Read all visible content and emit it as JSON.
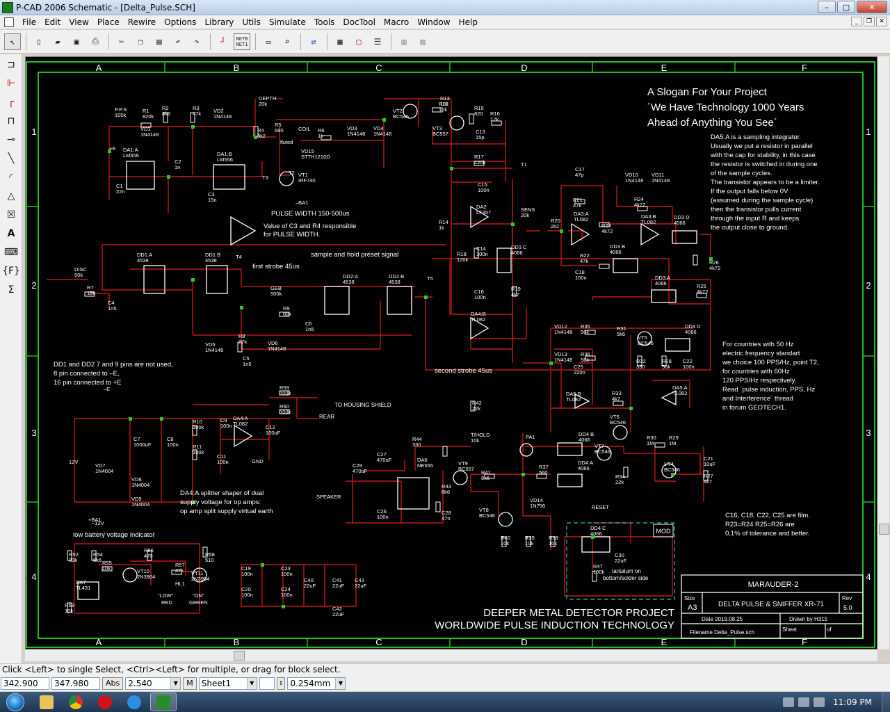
{
  "window": {
    "title": "P-CAD 2006 Schematic - [Delta_Pulse.SCH]",
    "controls": [
      "–",
      "□",
      "✕"
    ]
  },
  "menu": [
    "File",
    "Edit",
    "View",
    "Place",
    "Rewire",
    "Options",
    "Library",
    "Utils",
    "Simulate",
    "Tools",
    "DocTool",
    "Macro",
    "Window",
    "Help"
  ],
  "toolbar": {
    "netlist_top": "NETB",
    "netlist_bottom": "NET1"
  },
  "schematic": {
    "columns": [
      "A",
      "B",
      "C",
      "D",
      "E",
      "F"
    ],
    "rows": [
      "1",
      "2",
      "3",
      "4"
    ],
    "slogan": [
      "A Slogan For Your Project",
      "´We Have Technology 1000 Years",
      "Ahead of Anything You See´"
    ],
    "note_da5": [
      "DA5:A is a sampling integrator.",
      "Usually we put a resistor in parallel",
      "with the cap for stability, in this case",
      "the resistor is switched in during one",
      "of the sample cycles.",
      "The transistor appears to be a limiter.",
      "If the output falls below 0V",
      "(assumed during the sample cycle)",
      "then the transistor pulls current",
      "through the input R and keeps",
      "the output close to ground."
    ],
    "note_pps": [
      "For countries with 50 Hz",
      "electric frequency standart",
      "we choice 100 PPS/Hz, point T2,",
      "for countries with 60Hz",
      "120 PPS/Hz respectively.",
      "Read ´pulse induction, PPS, Hz",
      "and Interference´ thread",
      "in forum GEOTECH1."
    ],
    "note_dd": [
      "DD1 and DD2 7 and 9 pins are not used,",
      "8 pin connected to –E,",
      "16 pin connected to +E"
    ],
    "note_da4": [
      "DA4:A splitter shaper of dual",
      "supply voltage for op amps:",
      "op amp split supply virtual earth"
    ],
    "note_film": [
      "C16, C18, C22, C25 are film.",
      "R23=R24 R25=R26 are",
      "0,1% of tolerance and better."
    ],
    "label_pulse_width": "PULSE WIDTH 150-500us",
    "label_c3r4": [
      "Value of C3 and R4 responsible",
      "for PULSE WIDTH."
    ],
    "label_sample_hold": "sample and hold preset signal",
    "label_first_strobe": "first strobe 45us",
    "label_second_strobe": "second strobe 45us",
    "label_low_battery": "low battery voltage indicator",
    "label_housing": "TO HOUSING SHIELD",
    "label_rear": "REAR",
    "label_tantalum": [
      "tantalum on",
      "bottom/solder side"
    ],
    "label_mod": "MOD",
    "title_block": {
      "project": "MARAUDER-2",
      "size_label": "Size",
      "size": "A3",
      "name": "DELTA PULSE & SNIFFER XR-71",
      "rev_label": "Rev",
      "rev": "5.0",
      "date": "Date   2019.08.25",
      "drawn": "Drawn by  H315",
      "filename": "Filename Delta_Pulse.sch",
      "sheet": "Sheet",
      "of": "of"
    },
    "footer": [
      "DEEPER METAL DETECTOR PROJECT",
      "WORLDWIDE PULSE INDUCTION TECHNOLOGY"
    ],
    "components": [
      {
        "ref": "P.P.S",
        "val": "100k"
      },
      {
        "ref": "R1",
        "val": "820k"
      },
      {
        "ref": "R2",
        "val": "8k6"
      },
      {
        "ref": "R3",
        "val": "47k"
      },
      {
        "ref": "VD2",
        "val": "1N4148"
      },
      {
        "ref": "VD1",
        "val": "1N4148"
      },
      {
        "ref": "DA1:A",
        "val": "LM556"
      },
      {
        "ref": "DA1:B",
        "val": "LM556"
      },
      {
        "ref": "C1",
        "val": "22n"
      },
      {
        "ref": "C2",
        "val": "1n"
      },
      {
        "ref": "C3",
        "val": "15n"
      },
      {
        "ref": "DEPTH",
        "val": "20k"
      },
      {
        "ref": "R4",
        "val": "8k2"
      },
      {
        "ref": "R5",
        "val": "680"
      },
      {
        "ref": "COIL",
        "val": ""
      },
      {
        "ref": "R6",
        "val": "1k"
      },
      {
        "ref": "VD3",
        "val": "1N4148"
      },
      {
        "ref": "VD4",
        "val": "1N4148"
      },
      {
        "ref": "VD15",
        "val": "STTH1210D"
      },
      {
        "ref": "VT1",
        "val": "IRF740"
      },
      {
        "ref": "VT2",
        "val": "BC546"
      },
      {
        "ref": "R12",
        "val": "10k"
      },
      {
        "ref": "R13",
        "val": "10k"
      },
      {
        "ref": "VT3",
        "val": "BC557"
      },
      {
        "ref": "R15",
        "val": "820"
      },
      {
        "ref": "R16",
        "val": "12k"
      },
      {
        "ref": "C13",
        "val": "15p"
      },
      {
        "ref": "R17",
        "val": "120k"
      },
      {
        "ref": "C15",
        "val": "100n"
      },
      {
        "ref": "DA2",
        "val": "LF357"
      },
      {
        "ref": "R14",
        "val": "1k"
      },
      {
        "ref": "R18",
        "val": "120k"
      },
      {
        "ref": "C14",
        "val": "100n"
      },
      {
        "ref": "DD3 C",
        "val": "4066"
      },
      {
        "ref": "R19",
        "val": "4k7"
      },
      {
        "ref": "C16",
        "val": "100n"
      },
      {
        "ref": "DA4:B",
        "val": "TL082"
      },
      {
        "ref": "SENS",
        "val": "20k"
      },
      {
        "ref": "R20",
        "val": "2k2"
      },
      {
        "ref": "C17",
        "val": "47p"
      },
      {
        "ref": "R21",
        "val": "47k"
      },
      {
        "ref": "DA3:A",
        "val": "TL082"
      },
      {
        "ref": "R23",
        "val": "4k72"
      },
      {
        "ref": "R22",
        "val": "47k"
      },
      {
        "ref": "C18",
        "val": "100n"
      },
      {
        "ref": "VD10",
        "val": "1N4148"
      },
      {
        "ref": "VD11",
        "val": "1N4148"
      },
      {
        "ref": "R24",
        "val": "4k72"
      },
      {
        "ref": "DA3:B",
        "val": "TL082"
      },
      {
        "ref": "DD3 D",
        "val": "4066"
      },
      {
        "ref": "DD3 B",
        "val": "4066"
      },
      {
        "ref": "R26",
        "val": "4k72"
      },
      {
        "ref": "DD3:A",
        "val": "4066"
      },
      {
        "ref": "R25",
        "val": "4k72"
      },
      {
        "ref": "DISC",
        "val": "50k"
      },
      {
        "ref": "R7",
        "val": "15k"
      },
      {
        "ref": "C4",
        "val": "1n5"
      },
      {
        "ref": "DD1:A",
        "val": "4538"
      },
      {
        "ref": "DD1 B",
        "val": "4538"
      },
      {
        "ref": "GEB",
        "val": "500k"
      },
      {
        "ref": "R9",
        "val": "68k"
      },
      {
        "ref": "C6",
        "val": "1n5"
      },
      {
        "ref": "DD2:A",
        "val": "4538"
      },
      {
        "ref": "DD2 B",
        "val": "4538"
      },
      {
        "ref": "VD5",
        "val": "1N4148"
      },
      {
        "ref": "R8",
        "val": "27k"
      },
      {
        "ref": "C5",
        "val": "1n5"
      },
      {
        "ref": "VD6",
        "val": "1N4148"
      },
      {
        "ref": "VD12",
        "val": "1N4148"
      },
      {
        "ref": "R35",
        "val": "56k"
      },
      {
        "ref": "R31",
        "val": "5k6"
      },
      {
        "ref": "VT5",
        "val": "BC546"
      },
      {
        "ref": "DD4 D",
        "val": "4066"
      },
      {
        "ref": "VD13",
        "val": "1N4148"
      },
      {
        "ref": "R36",
        "val": "56k"
      },
      {
        "ref": "C25",
        "val": "220n"
      },
      {
        "ref": "R32",
        "val": "330"
      },
      {
        "ref": "R28",
        "val": "56k"
      },
      {
        "ref": "C22",
        "val": "100n"
      },
      {
        "ref": "DA5:B",
        "val": "TL082"
      },
      {
        "ref": "R33",
        "val": "4k7"
      },
      {
        "ref": "DA5:A",
        "val": "TL082"
      },
      {
        "ref": "VT6",
        "val": "BC546"
      },
      {
        "ref": "R30",
        "val": "1M"
      },
      {
        "ref": "R29",
        "val": "1M"
      },
      {
        "ref": "C21",
        "val": "10uF"
      },
      {
        "ref": "R27",
        "val": "4k7"
      },
      {
        "ref": "VT4",
        "val": "BC546"
      },
      {
        "ref": "VT7",
        "val": "BC546"
      },
      {
        "ref": "R34",
        "val": "22k"
      },
      {
        "ref": "DD4 B",
        "val": "4066"
      },
      {
        "ref": "DD4:A",
        "val": "4066"
      },
      {
        "ref": "T/HOLD",
        "val": "10k"
      },
      {
        "ref": "R42",
        "val": "22k"
      },
      {
        "ref": "PA1",
        "val": ""
      },
      {
        "ref": "R37",
        "val": "560"
      },
      {
        "ref": "R41",
        "val": "8k6"
      },
      {
        "ref": "VT9",
        "val": "BC557"
      },
      {
        "ref": "R44",
        "val": "330"
      },
      {
        "ref": "C27",
        "val": "470uF"
      },
      {
        "ref": "DA6",
        "val": "NE555"
      },
      {
        "ref": "C29",
        "val": "470uF"
      },
      {
        "ref": "R43",
        "val": "8k6"
      },
      {
        "ref": "C26",
        "val": "100n"
      },
      {
        "ref": "C28",
        "val": "47n"
      },
      {
        "ref": "VT8",
        "val": "BC546"
      },
      {
        "ref": "VD14",
        "val": "1N756"
      },
      {
        "ref": "R40",
        "val": "10k"
      },
      {
        "ref": "R39",
        "val": "10k"
      },
      {
        "ref": "R38",
        "val": "10k"
      },
      {
        "ref": "DD4 C",
        "val": "4066"
      },
      {
        "ref": "C30",
        "val": "22uF"
      },
      {
        "ref": "R47",
        "val": "100k"
      },
      {
        "ref": "R59",
        "val": "100k"
      },
      {
        "ref": "R60",
        "val": "100k"
      },
      {
        "ref": "R10",
        "val": "100k"
      },
      {
        "ref": "C9",
        "val": "100n"
      },
      {
        "ref": "DA4:A",
        "val": "TL082"
      },
      {
        "ref": "C12",
        "val": "100uF"
      },
      {
        "ref": "C7",
        "val": "1000uF"
      },
      {
        "ref": "C8",
        "val": "100n"
      },
      {
        "ref": "R11",
        "val": "100k"
      },
      {
        "ref": "C11",
        "val": "100n"
      },
      {
        "ref": "VD7",
        "val": "1N4004"
      },
      {
        "ref": "VD8",
        "val": "1N4004"
      },
      {
        "ref": "VD9",
        "val": "1N4004"
      },
      {
        "ref": "R52",
        "val": "33k"
      },
      {
        "ref": "R54",
        "val": "5k6"
      },
      {
        "ref": "R55",
        "val": "10k"
      },
      {
        "ref": "R56",
        "val": "470"
      },
      {
        "ref": "VT10",
        "val": "2N3904"
      },
      {
        "ref": "R57",
        "val": "47k"
      },
      {
        "ref": "VT11",
        "val": "2N3904"
      },
      {
        "ref": "R58",
        "val": "510"
      },
      {
        "ref": "DA7",
        "val": "TL431"
      },
      {
        "ref": "R53",
        "val": "10k"
      },
      {
        "ref": "HL1",
        "val": ""
      },
      {
        "ref": "C19",
        "val": "100n"
      },
      {
        "ref": "C20",
        "val": "100n"
      },
      {
        "ref": "C23",
        "val": "100n"
      },
      {
        "ref": "C24",
        "val": "100n"
      },
      {
        "ref": "C40",
        "val": "22uF"
      },
      {
        "ref": "C41",
        "val": "22uF"
      },
      {
        "ref": "C42",
        "val": "22uF"
      },
      {
        "ref": "C43",
        "val": "22uF"
      }
    ],
    "misc_labels": [
      "T1",
      "T2",
      "T3",
      "T4",
      "T5",
      "12V",
      "SPEAKER",
      "RESET",
      "GND",
      "“LOW”",
      "RED",
      "“ON”",
      "GREEN",
      "fluted",
      "+E",
      "–E",
      "–BA1",
      "+BA1",
      "−12V"
    ]
  },
  "status": {
    "hint": "Click <Left> to single Select, <Ctrl><Left> for multiple, or drag for block select.",
    "x": "342.900",
    "y": "347.980",
    "abs": "Abs",
    "grid": "2.540",
    "m": "M",
    "sheet": "Sheet1",
    "width": "0.254mm"
  },
  "taskbar": {
    "time": "11:09 PM"
  },
  "colors": {
    "wire": "#c01818",
    "component": "#ffffff",
    "junction": "#20d020",
    "border": "#20c020",
    "canvas": "#000000"
  }
}
